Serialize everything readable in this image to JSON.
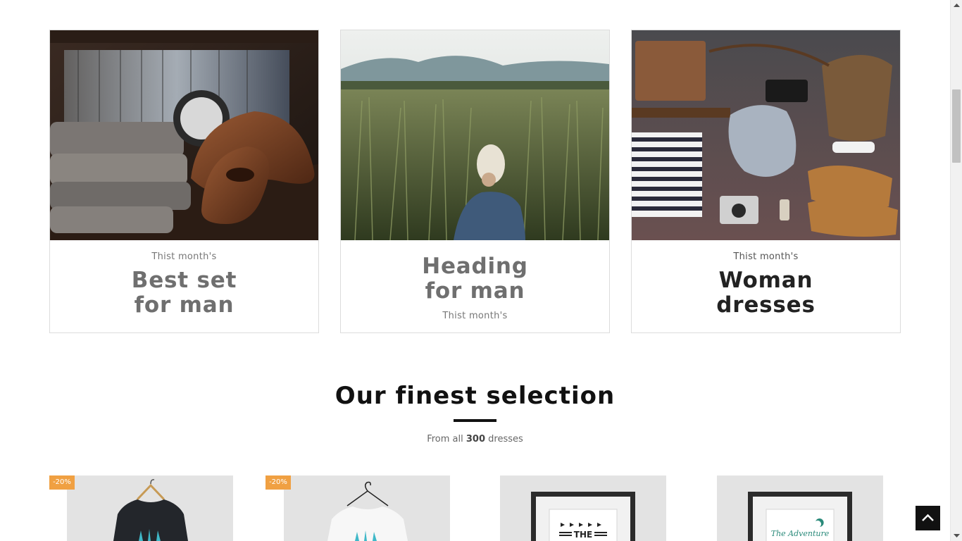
{
  "categories": [
    {
      "kicker": "Thist month's",
      "heading_line1": "Best set",
      "heading_line2": "for man"
    },
    {
      "kicker": "Thist month's",
      "heading_line1": "Heading",
      "heading_line2": "for man"
    },
    {
      "kicker": "Thist month's",
      "heading_line1": "Woman",
      "heading_line2": "dresses"
    }
  ],
  "section": {
    "title": "Our finest selection",
    "subtitle_prefix": "From all",
    "subtitle_count": "300",
    "subtitle_suffix": "dresses"
  },
  "products": [
    {
      "badge": "-20%",
      "image": "black-tshirt-on-hanger"
    },
    {
      "badge": "-20%",
      "image": "white-tshirt-on-hanger"
    },
    {
      "image": "framed-poster-the",
      "poster_text": "THE"
    },
    {
      "image": "framed-poster-adventure",
      "poster_text": "The Adventure"
    }
  ],
  "icons": {
    "back_to_top": "chevron-up-icon",
    "scroll_up": "triangle-up-icon",
    "scroll_down": "triangle-down-icon"
  },
  "colors": {
    "badge": "#f0a042",
    "accent_rule": "#111111",
    "back_to_top_bg": "#111111"
  }
}
